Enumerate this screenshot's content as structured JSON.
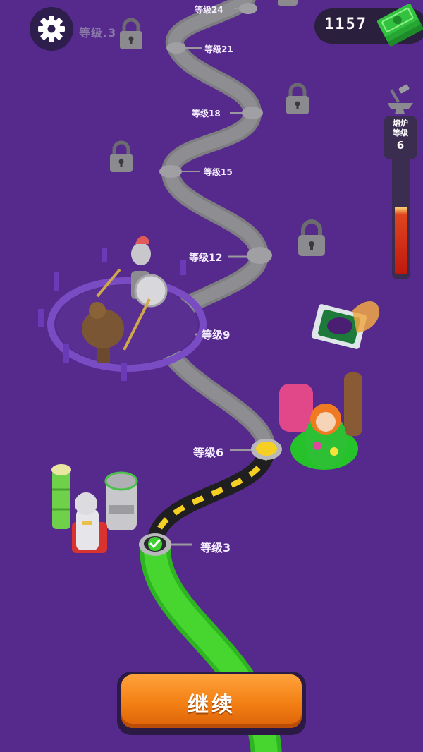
{
  "hud": {
    "level_indicator": "等级.3",
    "currency": "1157",
    "forge_label": "熔炉 等级",
    "forge_level": "6",
    "forge_progress": 0.62
  },
  "level_nodes": [
    {
      "level": 24,
      "label": "等级24",
      "state": "locked"
    },
    {
      "level": 21,
      "label": "等级21",
      "state": "locked"
    },
    {
      "level": 18,
      "label": "等级18",
      "state": "locked"
    },
    {
      "level": 15,
      "label": "等级15",
      "state": "locked"
    },
    {
      "level": 12,
      "label": "等级12",
      "state": "locked"
    },
    {
      "level": 9,
      "label": "等级9",
      "state": "locked"
    },
    {
      "level": 6,
      "label": "等级6",
      "state": "next"
    },
    {
      "level": 3,
      "label": "等级3",
      "state": "completed"
    }
  ],
  "buttons": {
    "continue_label": "继续"
  },
  "icons": {
    "settings": "gear-icon",
    "currency": "cash-stack-icon",
    "forge": "anvil-hammer-icon",
    "lock": "padlock-icon",
    "completed": "checkmark-icon"
  },
  "colors": {
    "background": "#562a8c",
    "path_locked": "#808080",
    "path_active": "#1f1f1f",
    "path_dash": "#f5d023",
    "path_completed": "#3ccd2a",
    "button": "#f28a1c",
    "cash": "#2fbf3a"
  }
}
